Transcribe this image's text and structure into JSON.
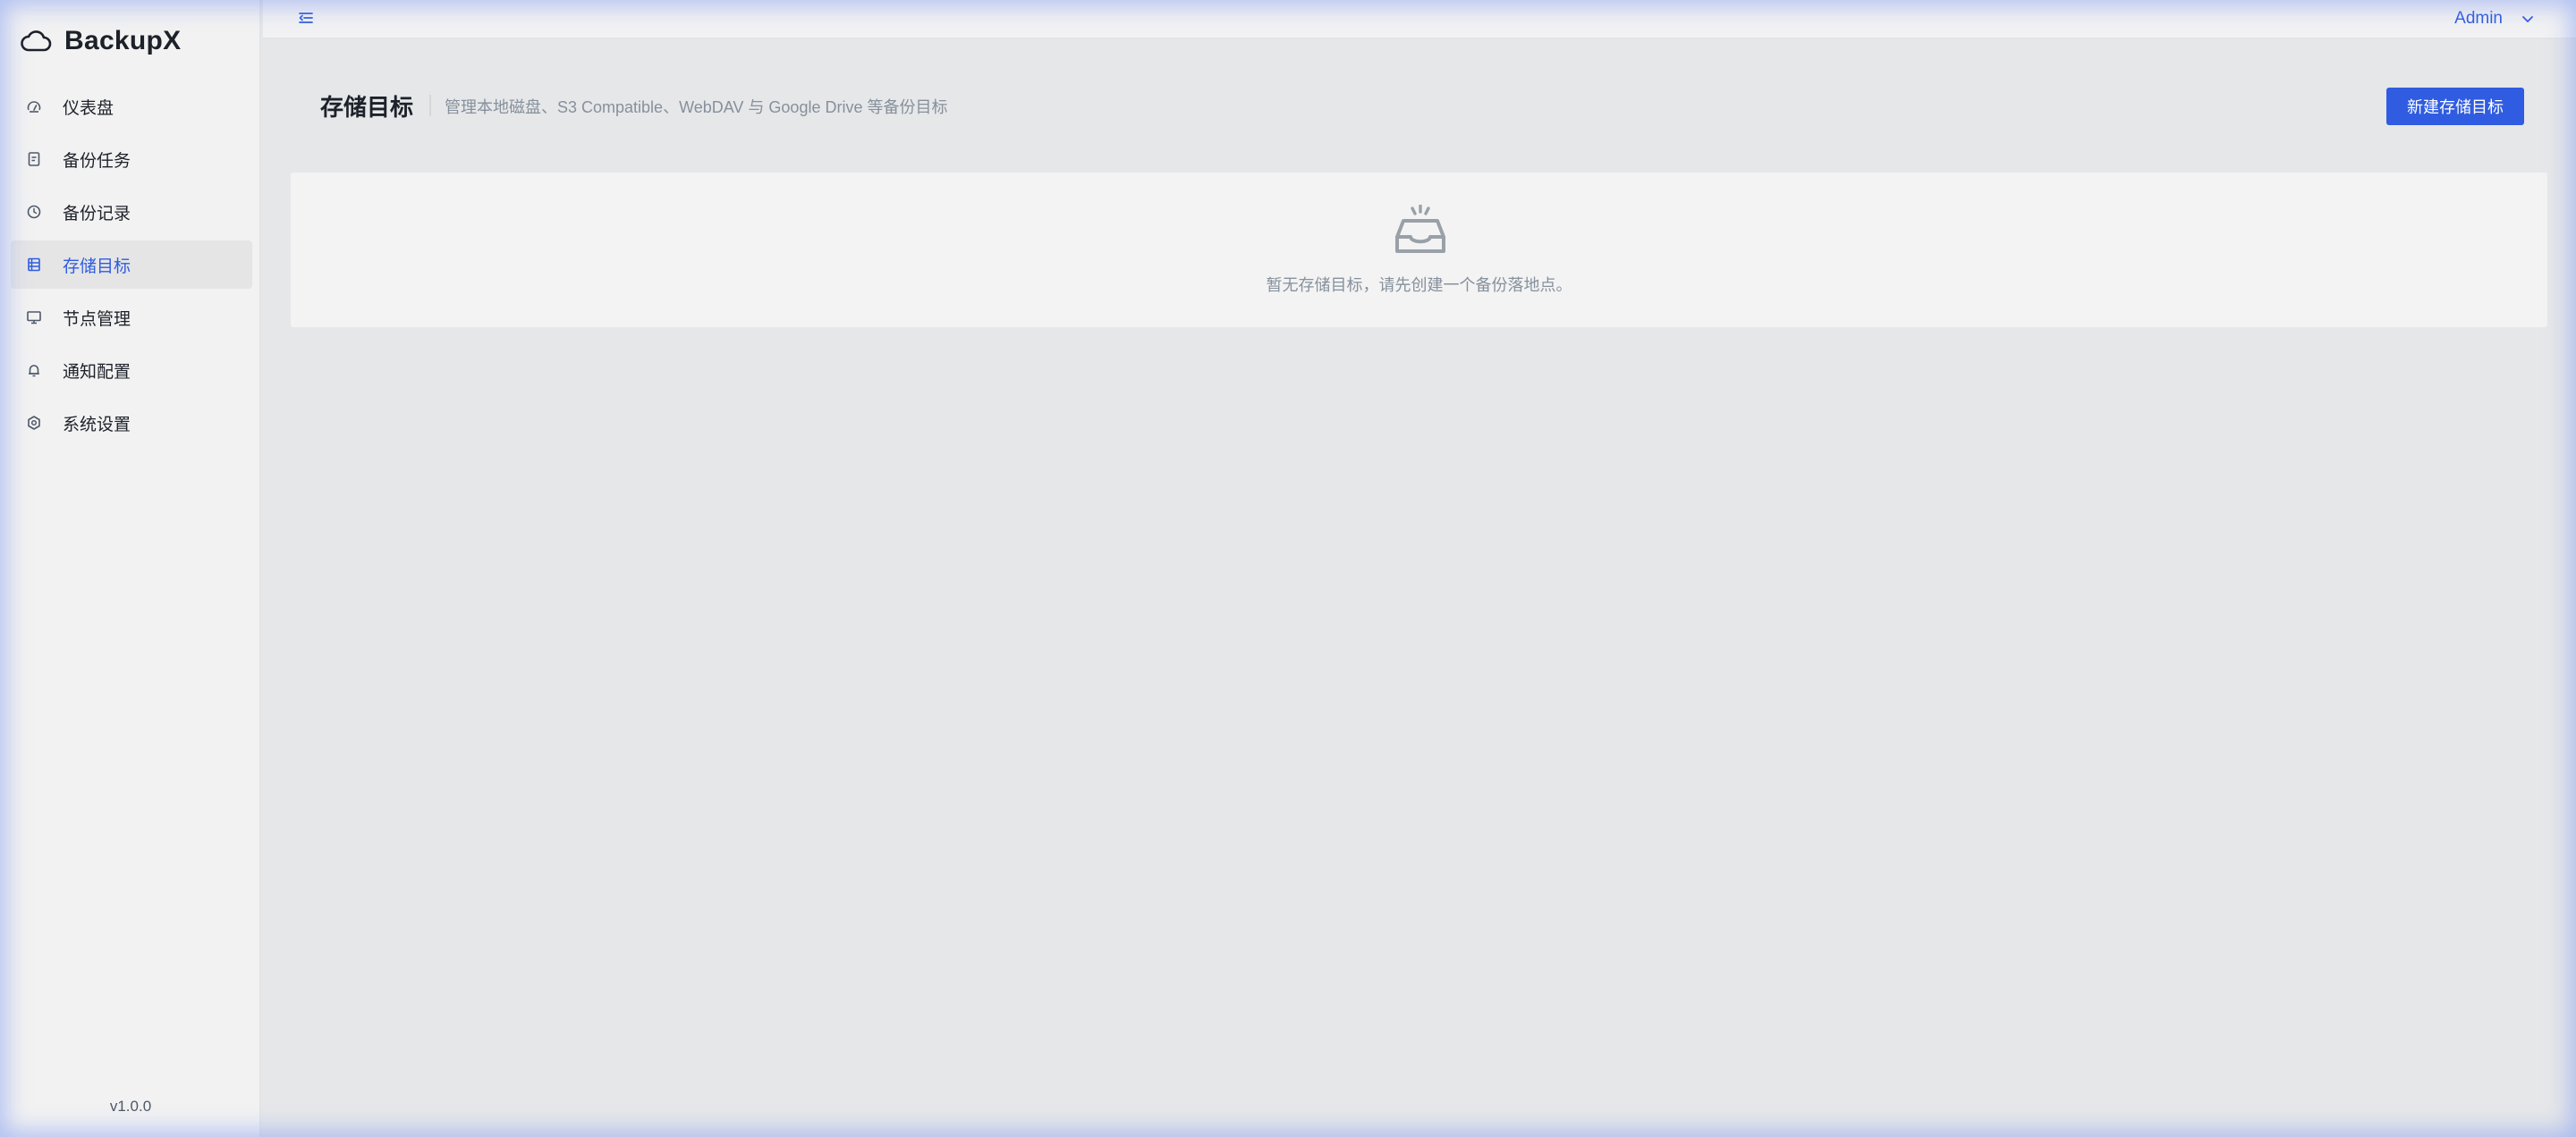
{
  "app": {
    "name": "BackupX",
    "version": "v1.0.0"
  },
  "sidebar": {
    "items": [
      {
        "label": "仪表盘",
        "icon": "dashboard-icon",
        "active": false
      },
      {
        "label": "备份任务",
        "icon": "task-file-icon",
        "active": false
      },
      {
        "label": "备份记录",
        "icon": "history-clock-icon",
        "active": false
      },
      {
        "label": "存储目标",
        "icon": "storage-list-icon",
        "active": true
      },
      {
        "label": "节点管理",
        "icon": "monitor-icon",
        "active": false
      },
      {
        "label": "通知配置",
        "icon": "bell-icon",
        "active": false
      },
      {
        "label": "系统设置",
        "icon": "settings-gear-icon",
        "active": false
      }
    ]
  },
  "topbar": {
    "user": "Admin"
  },
  "page": {
    "title": "存储目标",
    "subtitle": "管理本地磁盘、S3 Compatible、WebDAV 与 Google Drive 等备份目标",
    "create_button": "新建存储目标"
  },
  "empty_state": {
    "text": "暂无存储目标，请先创建一个备份落地点。"
  },
  "colors": {
    "accent": "#2f5ce0",
    "text": "#1d2129",
    "muted": "#86909c"
  }
}
